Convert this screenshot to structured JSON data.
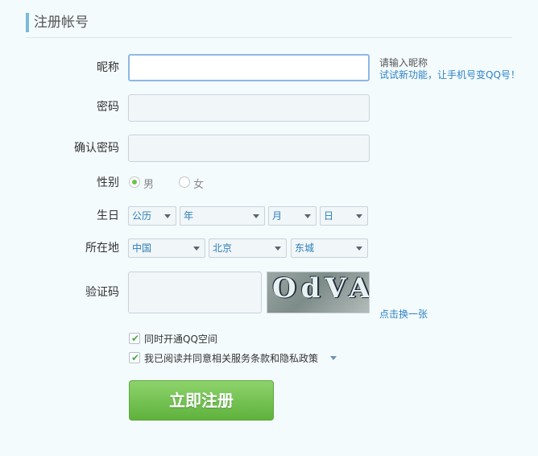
{
  "header": {
    "title": "注册帐号"
  },
  "fields": {
    "nickname": {
      "label": "昵称",
      "value": "",
      "hint": "请输入昵称",
      "tip": "试试新功能，让手机号变QQ号！"
    },
    "password": {
      "label": "密码",
      "value": ""
    },
    "confirm_password": {
      "label": "确认密码",
      "value": ""
    },
    "gender": {
      "label": "性别",
      "options": [
        "男",
        "女"
      ],
      "selected": "男"
    },
    "birthday": {
      "label": "生日",
      "calendar": "公历",
      "year": "年",
      "month": "月",
      "day": "日"
    },
    "location": {
      "label": "所在地",
      "country": "中国",
      "province": "北京",
      "city": "东城"
    },
    "captcha": {
      "label": "验证码",
      "value": "",
      "image_text": "OdVA",
      "refresh": "点击换一张"
    }
  },
  "options": {
    "qzone": {
      "label": "同时开通QQ空间",
      "checked": true
    },
    "agreement": {
      "label": "我已阅读并同意相关服务条款和隐私政策",
      "checked": true
    }
  },
  "submit": {
    "label": "立即注册"
  },
  "colors": {
    "accent_green": "#6cc24a",
    "link_blue": "#2e83c4",
    "header_bar": "#7bbad8"
  }
}
